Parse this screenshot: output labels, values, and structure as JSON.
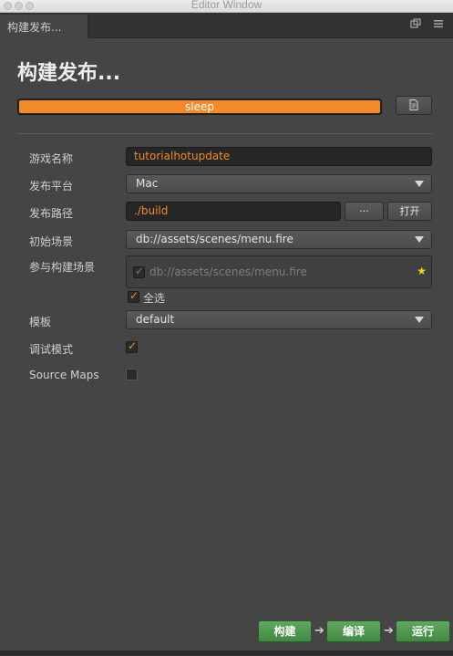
{
  "window": {
    "title": "Editor Window"
  },
  "tab": {
    "label": "构建发布...",
    "icons": [
      "popout-icon",
      "menu-icon"
    ]
  },
  "heading": "构建发布...",
  "progress": {
    "label": "sleep",
    "percent": 100,
    "color": "#f28a27"
  },
  "fields": {
    "game_name": {
      "label": "游戏名称",
      "value": "tutorialhotupdate"
    },
    "platform": {
      "label": "发布平台",
      "value": "Mac"
    },
    "path": {
      "label": "发布路径",
      "value": "./build",
      "browse_label": "···",
      "open_label": "打开"
    },
    "start_scene": {
      "label": "初始场景",
      "value": "db://assets/scenes/menu.fire"
    },
    "build_scenes": {
      "label": "参与构建场景",
      "items": [
        "db://assets/scenes/menu.fire"
      ],
      "select_all_label": "全选"
    },
    "template": {
      "label": "模板",
      "value": "default"
    },
    "debug": {
      "label": "调试模式",
      "checked": true
    },
    "source_maps": {
      "label": "Source Maps",
      "checked": false
    }
  },
  "actions": {
    "build": "构建",
    "compile": "编译",
    "run": "运行",
    "arrow": "➔"
  },
  "colors": {
    "accent": "#f28a27",
    "green": "#4f9a4f",
    "background": "#454545"
  }
}
